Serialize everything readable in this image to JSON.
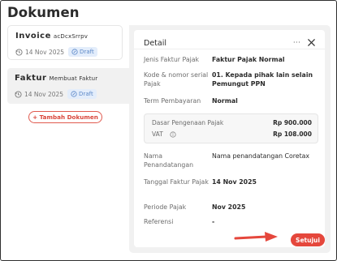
{
  "page_title": "Dokumen",
  "documents": [
    {
      "name": "Invoice",
      "sub": "acDcxSrrpv",
      "date": "14 Nov 2025",
      "status": "Draft"
    },
    {
      "name": "Faktur",
      "sub": "Membuat Faktur",
      "date": "14 Nov 2025",
      "status": "Draft"
    }
  ],
  "add_document_label": "+ Tambah Dokumen",
  "detail": {
    "title": "Detail",
    "more_label": "···",
    "rows": [
      {
        "label": "Jenis Faktur Pajak",
        "value": "Faktur Pajak Normal"
      },
      {
        "label": "Kode & nomor serial Pajak",
        "value": "01. Kepada pihak lain selain Pemungut PPN"
      },
      {
        "label": "Term Pembayaran",
        "value": "Normal"
      },
      {
        "label": "Nama Penandatangan",
        "value": "Nama penandatangan Coretax"
      },
      {
        "label": "Tanggal Faktur Pajak",
        "value": "14 Nov 2025"
      },
      {
        "label": "Periode Pajak",
        "value": "Nov 2025"
      },
      {
        "label": "Referensi",
        "value": "-"
      }
    ],
    "tax": [
      {
        "label": "Dasar Pengenaan Pajak",
        "value": "Rp 900.000"
      },
      {
        "label": "VAT",
        "value": "Rp 108.000"
      }
    ],
    "approve_label": "Setujui"
  },
  "colors": {
    "accent": "#e5473c",
    "draft_badge_bg": "#e3edfb",
    "draft_badge_text": "#5b87c7",
    "panel_bg": "#f1f1f1"
  },
  "icons": {
    "date": "clock-icon",
    "status": "draft-icon",
    "close": "close-icon",
    "info": "info-icon",
    "pointer": "arrow-icon"
  }
}
